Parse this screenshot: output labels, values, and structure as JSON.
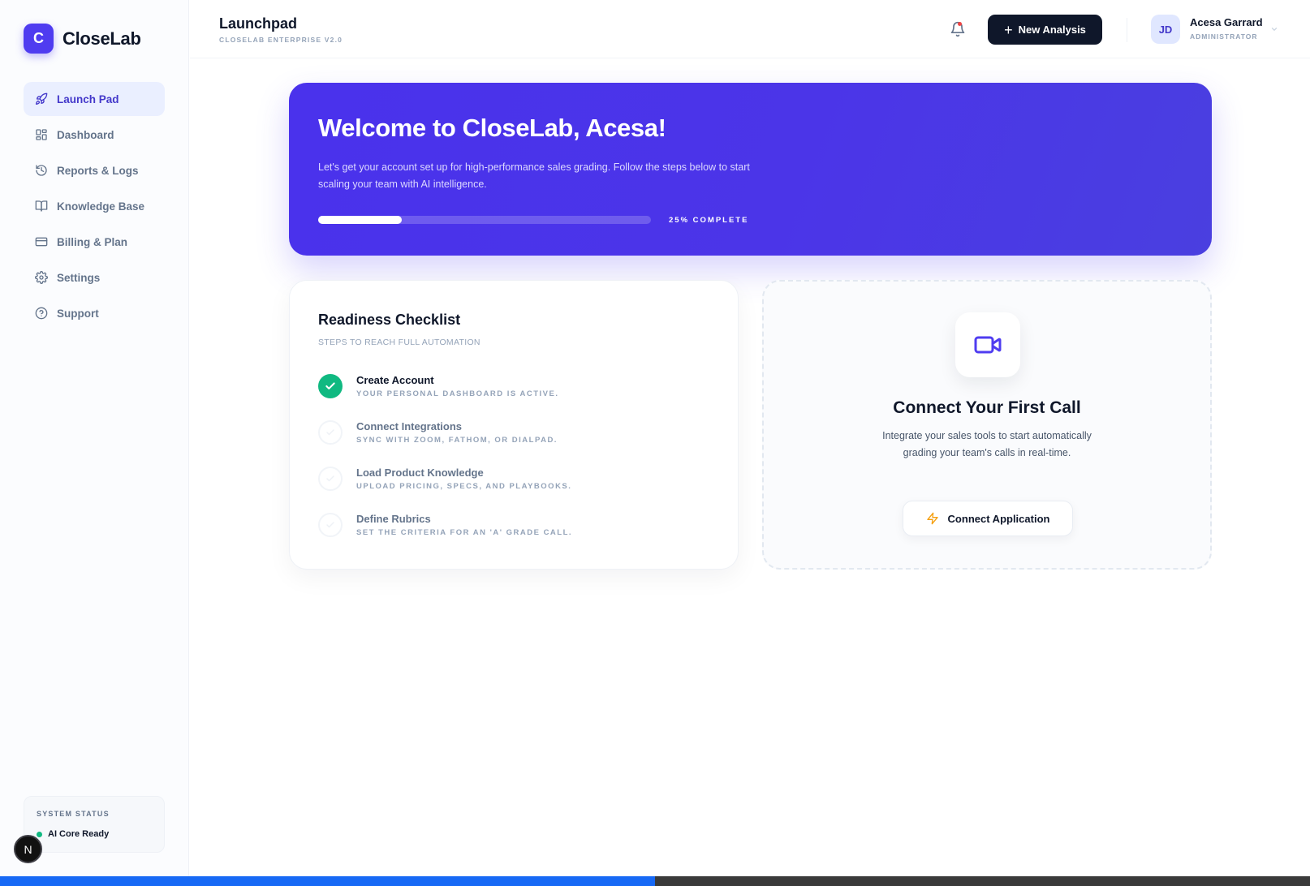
{
  "brand": {
    "initial": "C",
    "name": "CloseLab"
  },
  "sidebar": {
    "items": [
      {
        "label": "Launch Pad",
        "icon": "rocket-icon",
        "active": true
      },
      {
        "label": "Dashboard",
        "icon": "grid-icon",
        "active": false
      },
      {
        "label": "Reports & Logs",
        "icon": "history-icon",
        "active": false
      },
      {
        "label": "Knowledge Base",
        "icon": "book-icon",
        "active": false
      },
      {
        "label": "Billing & Plan",
        "icon": "credit-card-icon",
        "active": false
      },
      {
        "label": "Settings",
        "icon": "gear-icon",
        "active": false
      },
      {
        "label": "Support",
        "icon": "help-circle-icon",
        "active": false
      }
    ],
    "status": {
      "title": "SYSTEM STATUS",
      "text": "AI Core Ready",
      "color": "#10b981"
    },
    "badge": "N"
  },
  "header": {
    "title": "Launchpad",
    "subtitle": "CLOSELAB ENTERPRISE V2.0",
    "new_button": "New Analysis",
    "user": {
      "initials": "JD",
      "name": "Acesa Garrard",
      "role": "ADMINISTRATOR"
    }
  },
  "hero": {
    "title": "Welcome to CloseLab, Acesa!",
    "description": "Let's get your account set up for high-performance sales grading. Follow the steps below to start scaling your team with AI intelligence.",
    "progress_percent": 25,
    "progress_label": "25% COMPLETE"
  },
  "checklist": {
    "title": "Readiness Checklist",
    "subtitle": "STEPS TO REACH FULL AUTOMATION",
    "steps": [
      {
        "label": "Create Account",
        "desc": "YOUR PERSONAL DASHBOARD IS ACTIVE.",
        "done": true
      },
      {
        "label": "Connect Integrations",
        "desc": "SYNC WITH ZOOM, FATHOM, OR DIALPAD.",
        "done": false
      },
      {
        "label": "Load Product Knowledge",
        "desc": "UPLOAD PRICING, SPECS, AND PLAYBOOKS.",
        "done": false
      },
      {
        "label": "Define Rubrics",
        "desc": "SET THE CRITERIA FOR AN 'A' GRADE CALL.",
        "done": false
      }
    ]
  },
  "connect": {
    "title": "Connect Your First Call",
    "description": "Integrate your sales tools to start automatically grading your team's calls in real-time.",
    "button": "Connect Application"
  },
  "colors": {
    "accent": "#4f3cf0",
    "success": "#10b981",
    "dark": "#0f172a"
  }
}
